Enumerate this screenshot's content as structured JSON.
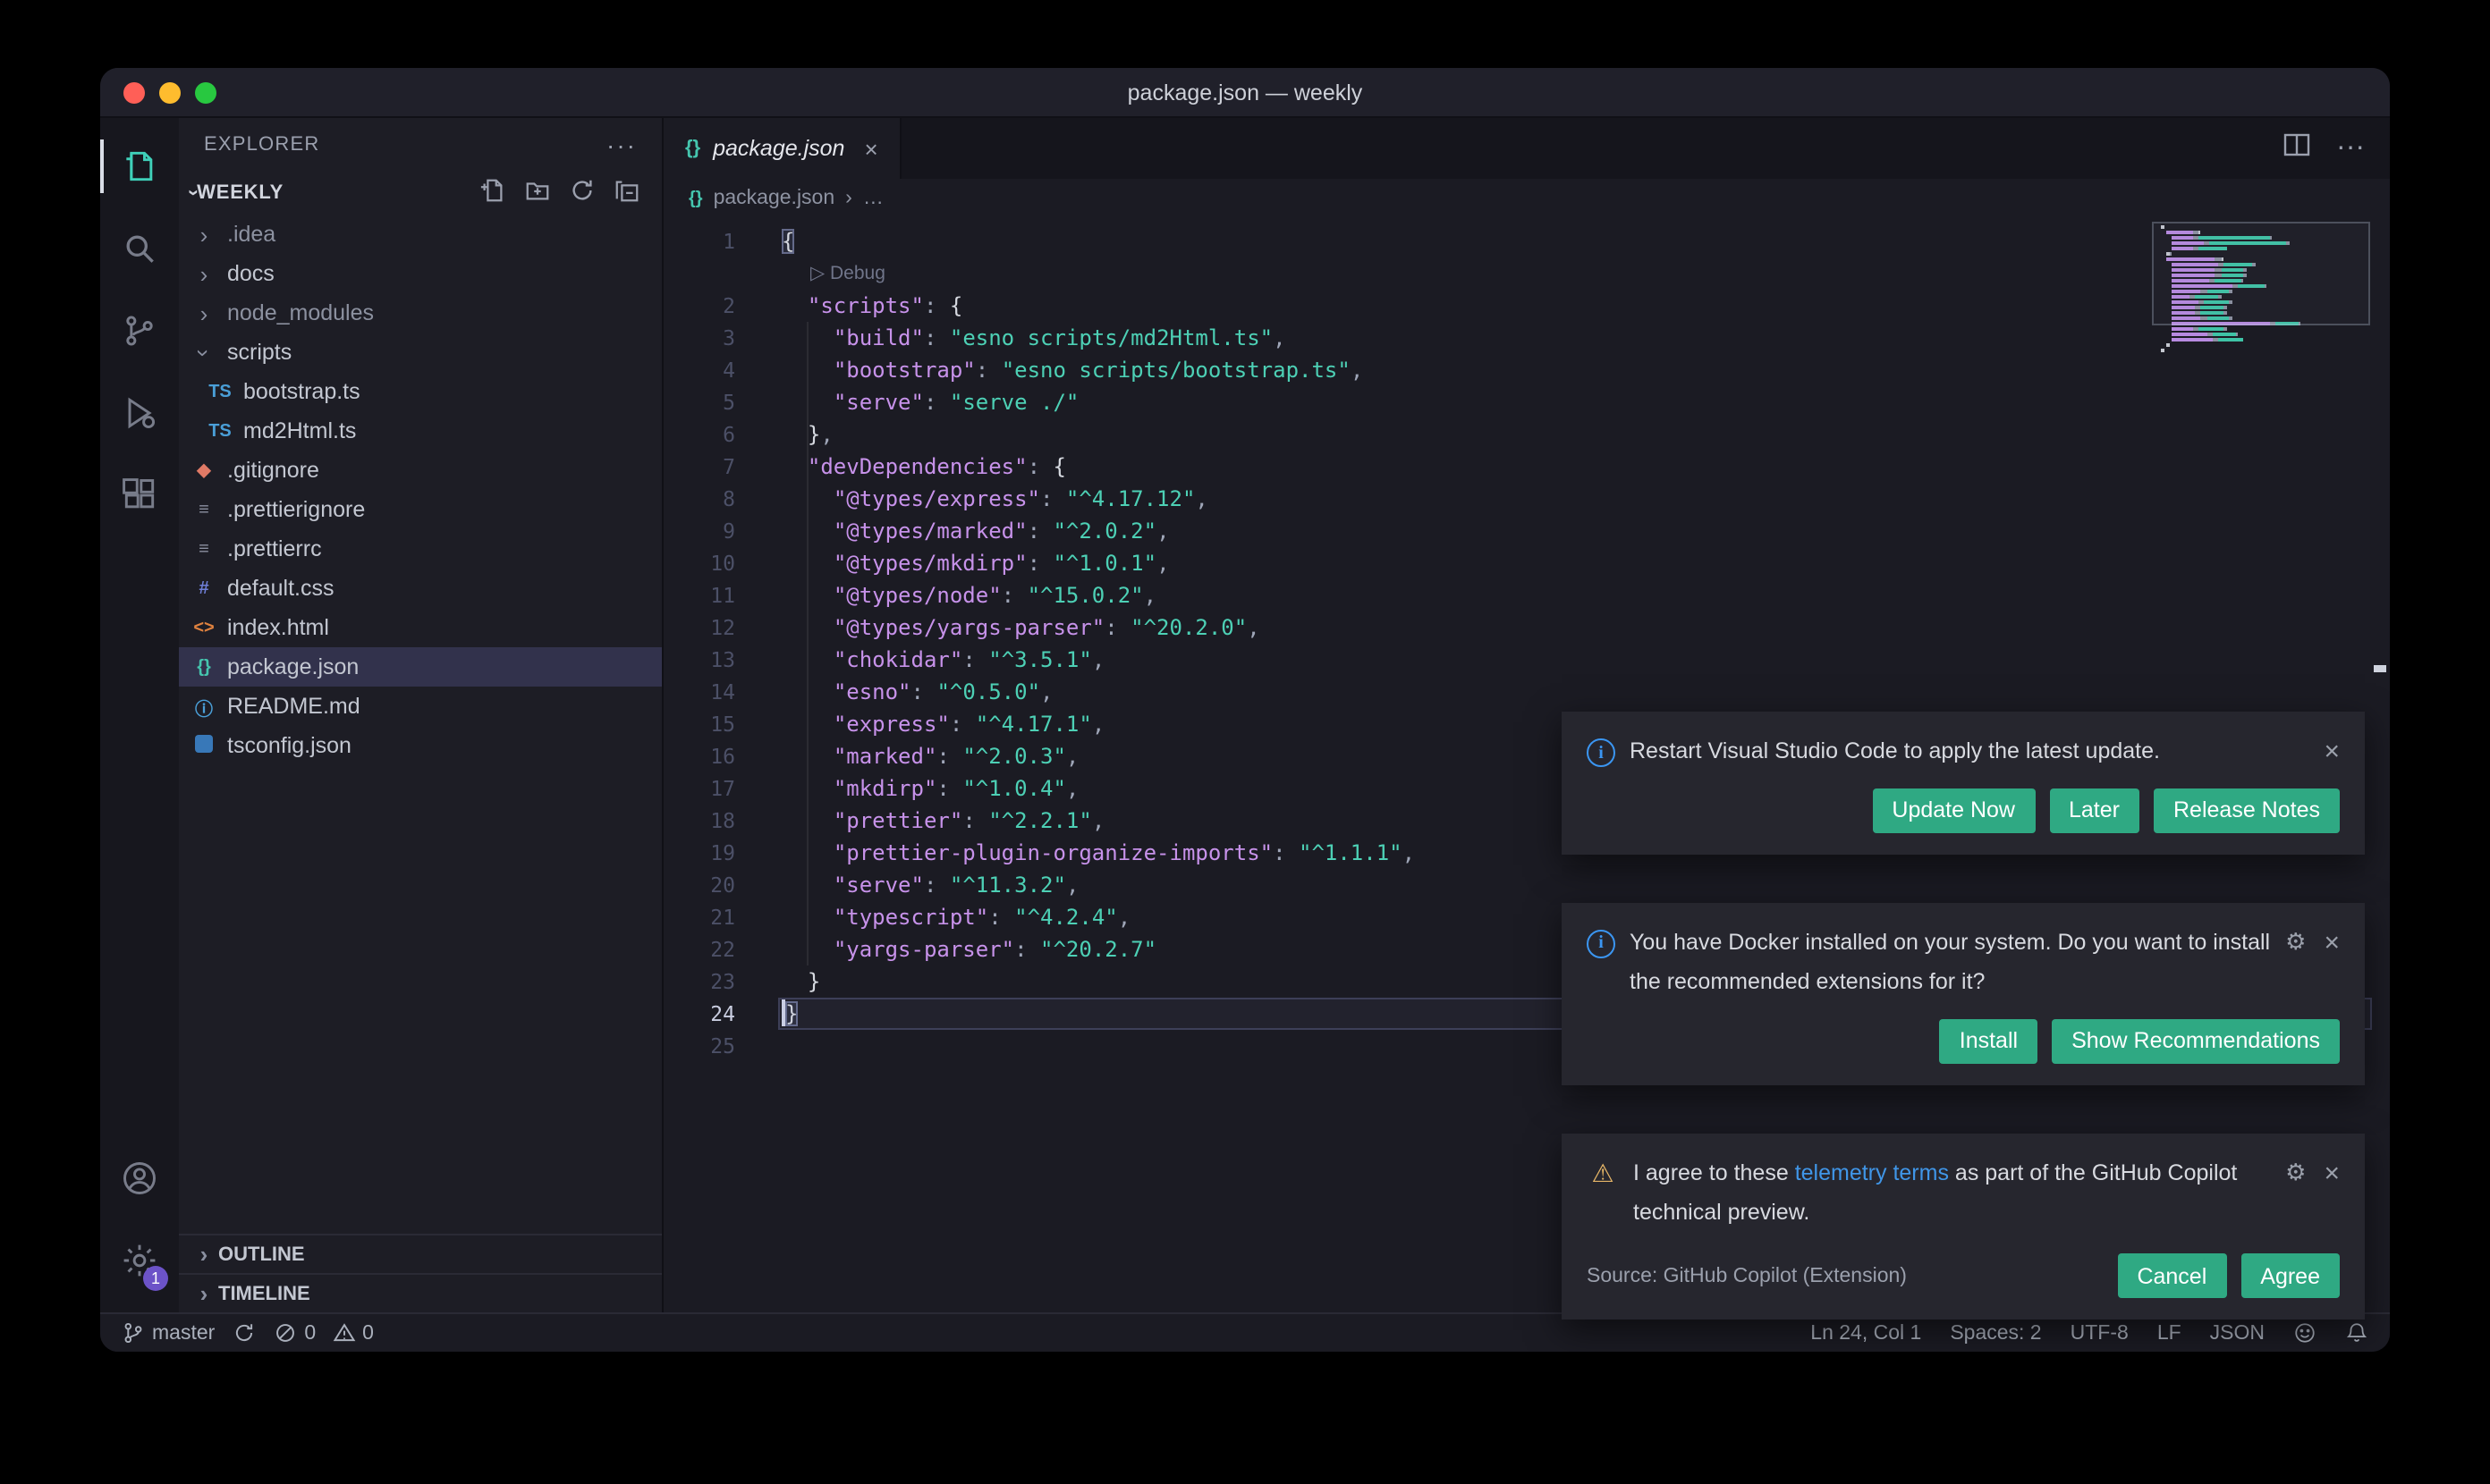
{
  "window": {
    "title": "package.json — weekly"
  },
  "activity_bar": {
    "items": [
      "explorer",
      "search",
      "source-control",
      "run-debug",
      "extensions"
    ],
    "bottom": [
      "account",
      "settings"
    ],
    "settings_badge": "1"
  },
  "sidebar": {
    "header": "EXPLORER",
    "header_more": "···",
    "section": "WEEKLY",
    "items": [
      {
        "label": ".idea",
        "kind": "folder-closed",
        "indent": 1,
        "dim": true
      },
      {
        "label": "docs",
        "kind": "folder-closed",
        "indent": 1
      },
      {
        "label": "node_modules",
        "kind": "folder-closed",
        "indent": 1,
        "dim": true
      },
      {
        "label": "scripts",
        "kind": "folder-open",
        "indent": 1
      },
      {
        "label": "bootstrap.ts",
        "kind": "ts",
        "indent": 2
      },
      {
        "label": "md2Html.ts",
        "kind": "ts",
        "indent": 2
      },
      {
        "label": ".gitignore",
        "kind": "git",
        "indent": 1
      },
      {
        "label": ".prettierignore",
        "kind": "prettier",
        "indent": 1
      },
      {
        "label": ".prettierrc",
        "kind": "prettier",
        "indent": 1
      },
      {
        "label": "default.css",
        "kind": "css",
        "indent": 1
      },
      {
        "label": "index.html",
        "kind": "html",
        "indent": 1
      },
      {
        "label": "package.json",
        "kind": "json",
        "indent": 1,
        "selected": true
      },
      {
        "label": "README.md",
        "kind": "info",
        "indent": 1
      },
      {
        "label": "tsconfig.json",
        "kind": "tsbox",
        "indent": 1
      }
    ],
    "panels": [
      "OUTLINE",
      "TIMELINE"
    ]
  },
  "editor": {
    "tab": "package.json",
    "tab_icon": "{}",
    "close_glyph": "×",
    "breadcrumb_file": "package.json",
    "breadcrumb_sep": "›",
    "breadcrumb_more": "…",
    "codelens": "Debug",
    "codelens_glyph": "▷",
    "rows": [
      {
        "n": 1,
        "t": [
          [
            "bm",
            "{"
          ]
        ]
      },
      {
        "lens": true
      },
      {
        "n": 2,
        "t": [
          [
            "",
            "  "
          ],
          [
            "k",
            "\"scripts\""
          ],
          [
            "p",
            ": "
          ],
          [
            "b",
            "{"
          ]
        ]
      },
      {
        "n": 3,
        "t": [
          [
            "",
            "    "
          ],
          [
            "k",
            "\"build\""
          ],
          [
            "p",
            ": "
          ],
          [
            "s",
            "\"esno scripts/md2Html.ts\""
          ],
          [
            "p",
            ","
          ]
        ]
      },
      {
        "n": 4,
        "t": [
          [
            "",
            "    "
          ],
          [
            "k",
            "\"bootstrap\""
          ],
          [
            "p",
            ": "
          ],
          [
            "s",
            "\"esno scripts/bootstrap.ts\""
          ],
          [
            "p",
            ","
          ]
        ]
      },
      {
        "n": 5,
        "t": [
          [
            "",
            "    "
          ],
          [
            "k",
            "\"serve\""
          ],
          [
            "p",
            ": "
          ],
          [
            "s",
            "\"serve ./\""
          ]
        ]
      },
      {
        "n": 6,
        "t": [
          [
            "",
            "  "
          ],
          [
            "b",
            "}"
          ],
          [
            "p",
            ","
          ]
        ]
      },
      {
        "n": 7,
        "t": [
          [
            "",
            "  "
          ],
          [
            "k",
            "\"devDependencies\""
          ],
          [
            "p",
            ": "
          ],
          [
            "b",
            "{"
          ]
        ]
      },
      {
        "n": 8,
        "t": [
          [
            "",
            "    "
          ],
          [
            "k",
            "\"@types/express\""
          ],
          [
            "p",
            ": "
          ],
          [
            "s",
            "\"^4.17.12\""
          ],
          [
            "p",
            ","
          ]
        ]
      },
      {
        "n": 9,
        "t": [
          [
            "",
            "    "
          ],
          [
            "k",
            "\"@types/marked\""
          ],
          [
            "p",
            ": "
          ],
          [
            "s",
            "\"^2.0.2\""
          ],
          [
            "p",
            ","
          ]
        ]
      },
      {
        "n": 10,
        "t": [
          [
            "",
            "    "
          ],
          [
            "k",
            "\"@types/mkdirp\""
          ],
          [
            "p",
            ": "
          ],
          [
            "s",
            "\"^1.0.1\""
          ],
          [
            "p",
            ","
          ]
        ]
      },
      {
        "n": 11,
        "t": [
          [
            "",
            "    "
          ],
          [
            "k",
            "\"@types/node\""
          ],
          [
            "p",
            ": "
          ],
          [
            "s",
            "\"^15.0.2\""
          ],
          [
            "p",
            ","
          ]
        ]
      },
      {
        "n": 12,
        "t": [
          [
            "",
            "    "
          ],
          [
            "k",
            "\"@types/yargs-parser\""
          ],
          [
            "p",
            ": "
          ],
          [
            "s",
            "\"^20.2.0\""
          ],
          [
            "p",
            ","
          ]
        ]
      },
      {
        "n": 13,
        "t": [
          [
            "",
            "    "
          ],
          [
            "k",
            "\"chokidar\""
          ],
          [
            "p",
            ": "
          ],
          [
            "s",
            "\"^3.5.1\""
          ],
          [
            "p",
            ","
          ]
        ]
      },
      {
        "n": 14,
        "t": [
          [
            "",
            "    "
          ],
          [
            "k",
            "\"esno\""
          ],
          [
            "p",
            ": "
          ],
          [
            "s",
            "\"^0.5.0\""
          ],
          [
            "p",
            ","
          ]
        ]
      },
      {
        "n": 15,
        "t": [
          [
            "",
            "    "
          ],
          [
            "k",
            "\"express\""
          ],
          [
            "p",
            ": "
          ],
          [
            "s",
            "\"^4.17.1\""
          ],
          [
            "p",
            ","
          ]
        ]
      },
      {
        "n": 16,
        "t": [
          [
            "",
            "    "
          ],
          [
            "k",
            "\"marked\""
          ],
          [
            "p",
            ": "
          ],
          [
            "s",
            "\"^2.0.3\""
          ],
          [
            "p",
            ","
          ]
        ]
      },
      {
        "n": 17,
        "t": [
          [
            "",
            "    "
          ],
          [
            "k",
            "\"mkdirp\""
          ],
          [
            "p",
            ": "
          ],
          [
            "s",
            "\"^1.0.4\""
          ],
          [
            "p",
            ","
          ]
        ]
      },
      {
        "n": 18,
        "t": [
          [
            "",
            "    "
          ],
          [
            "k",
            "\"prettier\""
          ],
          [
            "p",
            ": "
          ],
          [
            "s",
            "\"^2.2.1\""
          ],
          [
            "p",
            ","
          ]
        ]
      },
      {
        "n": 19,
        "t": [
          [
            "",
            "    "
          ],
          [
            "k",
            "\"prettier-plugin-organize-imports\""
          ],
          [
            "p",
            ": "
          ],
          [
            "s",
            "\"^1.1.1\""
          ],
          [
            "p",
            ","
          ]
        ]
      },
      {
        "n": 20,
        "t": [
          [
            "",
            "    "
          ],
          [
            "k",
            "\"serve\""
          ],
          [
            "p",
            ": "
          ],
          [
            "s",
            "\"^11.3.2\""
          ],
          [
            "p",
            ","
          ]
        ]
      },
      {
        "n": 21,
        "t": [
          [
            "",
            "    "
          ],
          [
            "k",
            "\"typescript\""
          ],
          [
            "p",
            ": "
          ],
          [
            "s",
            "\"^4.2.4\""
          ],
          [
            "p",
            ","
          ]
        ]
      },
      {
        "n": 22,
        "t": [
          [
            "",
            "    "
          ],
          [
            "k",
            "\"yargs-parser\""
          ],
          [
            "p",
            ": "
          ],
          [
            "s",
            "\"^20.2.7\""
          ]
        ]
      },
      {
        "n": 23,
        "t": [
          [
            "",
            "  "
          ],
          [
            "b",
            "}"
          ]
        ]
      },
      {
        "n": 24,
        "t": [
          [
            "bm",
            "}"
          ]
        ],
        "current": true,
        "cursor": true
      },
      {
        "n": 25,
        "t": []
      }
    ]
  },
  "notifications": [
    {
      "icon": "info",
      "parts": [
        {
          "t": "Restart Visual Studio Code to apply the latest update."
        }
      ],
      "gear": false,
      "buttons": [
        "Update Now",
        "Later",
        "Release Notes"
      ]
    },
    {
      "icon": "info",
      "parts": [
        {
          "t": "You have Docker installed on your system. Do you want to install the recommended extensions for it?"
        }
      ],
      "gear": true,
      "buttons": [
        "Install",
        "Show Recommendations"
      ]
    },
    {
      "icon": "warning",
      "parts": [
        {
          "t": "I agree to these "
        },
        {
          "t": "telemetry terms",
          "link": true
        },
        {
          "t": " as part of the GitHub Copilot technical preview."
        }
      ],
      "gear": true,
      "source": "Source: GitHub Copilot (Extension)",
      "buttons": [
        "Cancel",
        "Agree"
      ]
    }
  ],
  "status_bar": {
    "branch": "master",
    "errors": "0",
    "warnings": "0",
    "right": [
      "Ln 24, Col 1",
      "Spaces: 2",
      "UTF-8",
      "LF",
      "JSON"
    ]
  },
  "colors": {
    "accent_button": "#2fa983",
    "key": "#c792ea",
    "string": "#4dd0b5",
    "link": "#4096e8",
    "active_icon": "#3fd0b9"
  }
}
